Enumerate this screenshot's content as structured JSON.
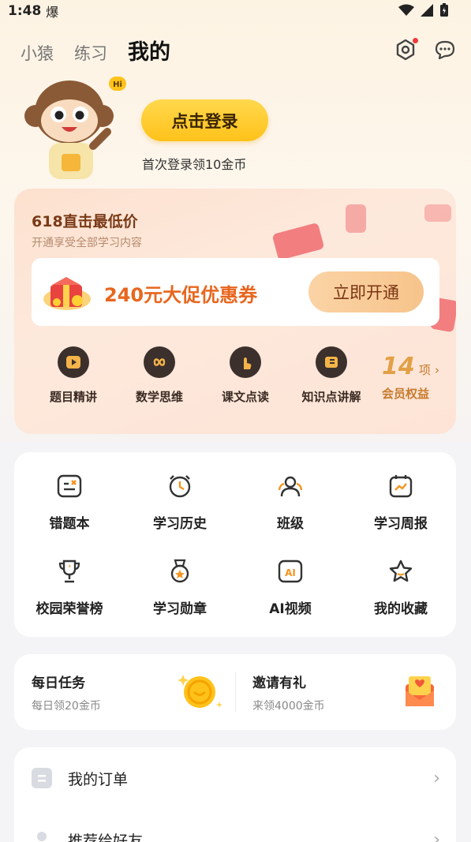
{
  "status": {
    "time": "1:48",
    "indicator": "爆"
  },
  "nav": {
    "tabs": [
      "小猿",
      "练习",
      "我的"
    ],
    "active": 2
  },
  "login": {
    "button": "点击登录",
    "hint": "首次登录领10金币"
  },
  "vip": {
    "title": "618直击最低价",
    "subtitle": "开通享受全部学习内容",
    "coupon_text": "240元大促优惠券",
    "coupon_button": "立即开通",
    "features": [
      "题目精讲",
      "数学思维",
      "课文点读",
      "知识点讲解"
    ],
    "count_number": "14",
    "count_unit": "项",
    "count_label": "会员权益"
  },
  "grid": {
    "items": [
      "错题本",
      "学习历史",
      "班级",
      "学习周报",
      "校园荣誉榜",
      "学习勋章",
      "AI视频",
      "我的收藏"
    ]
  },
  "tasks": [
    {
      "title": "每日任务",
      "sub": "每日领20金币"
    },
    {
      "title": "邀请有礼",
      "sub": "来领4000金币"
    }
  ],
  "list": [
    "我的订单",
    "推荐给好友"
  ],
  "colors": {
    "accent": "#ffc21a",
    "vip_text": "#e8661e",
    "orange": "#f5941e"
  }
}
